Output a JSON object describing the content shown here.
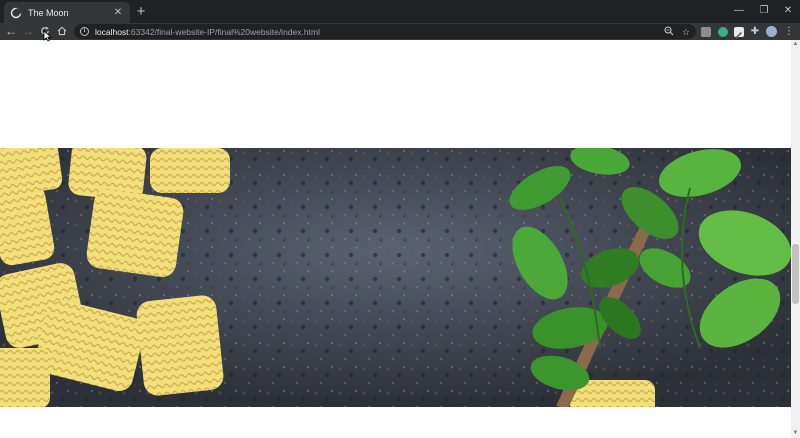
{
  "browser": {
    "tab": {
      "title": "The Moon",
      "favicon": "moon-icon",
      "close_icon": "close-icon"
    },
    "new_tab_icon": "plus-icon",
    "window_controls": [
      "minimize-icon",
      "restore-icon",
      "close-icon"
    ],
    "nav": [
      "back-arrow-icon",
      "forward-arrow-icon",
      "reload-icon",
      "home-icon"
    ],
    "address_bar": {
      "host": "localhost",
      "rest": ":63342/final-website-IP/final%20website/index.html",
      "left_icon": "info-icon",
      "right_icons": [
        "zoom-icon",
        "bookmark-star-icon"
      ]
    },
    "extensions": [
      "extension-gray-icon",
      "extension-green-icon",
      "extension-pencil-icon",
      "extensions-puzzle-icon",
      "profile-avatar-icon",
      "menu-kebab-icon"
    ]
  },
  "page": {
    "hero_image": {
      "subject": "pasta-and-basil-on-dark-stone",
      "colors": {
        "background": "#3a3f47",
        "pasta": "#f0dc78",
        "basil": "#3c8f2c"
      }
    }
  }
}
